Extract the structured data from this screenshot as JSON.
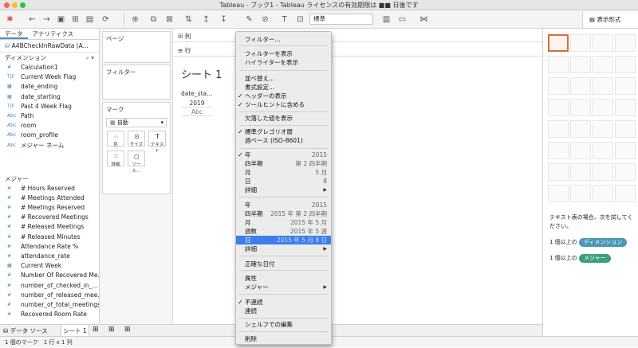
{
  "window": {
    "title": "Tableau - ブック1 - Tableau ライセンスの有効期限は ■■ 日後です"
  },
  "toolbar": {
    "fit_value": "標準",
    "show_me_label": "表示形式"
  },
  "left_pane": {
    "tab_data": "データ",
    "tab_analytics": "アナリティクス",
    "datasource": "A4BCheckInRawData (A...",
    "dimensions_header": "ディメンション",
    "dimensions": [
      {
        "icon": "#",
        "label": "Calculation1"
      },
      {
        "icon": "T|F",
        "label": "Current Week Flag"
      },
      {
        "icon": "▦",
        "label": "date_ending"
      },
      {
        "icon": "▦",
        "label": "date_starting"
      },
      {
        "icon": "T|F",
        "label": "Past 4 Week Flag"
      },
      {
        "icon": "Abc",
        "label": "Path"
      },
      {
        "icon": "Abc",
        "label": "room"
      },
      {
        "icon": "Abc",
        "label": "room_profile"
      },
      {
        "icon": "Abc",
        "label": "メジャー ネーム"
      }
    ],
    "measures_header": "メジャー",
    "measures": [
      {
        "icon": "#",
        "label": "# Hours Reserved"
      },
      {
        "icon": "#",
        "label": "# Meetings Attended"
      },
      {
        "icon": "#",
        "label": "# Meetings Reserved"
      },
      {
        "icon": "#",
        "label": "# Recovered Meetings"
      },
      {
        "icon": "#",
        "label": "# Released Meetings"
      },
      {
        "icon": "#",
        "label": "# Released Minutes"
      },
      {
        "icon": "#",
        "label": "Attendance Rate %"
      },
      {
        "icon": "#",
        "label": "attendance_rate"
      },
      {
        "icon": "▦",
        "label": "Current Week"
      },
      {
        "icon": "#",
        "label": "Number Of Recovered Me..."
      },
      {
        "icon": "#",
        "label": "number_of_checked_in_..."
      },
      {
        "icon": "#",
        "label": "number_of_released_mee..."
      },
      {
        "icon": "#",
        "label": "number_of_total_meetings"
      },
      {
        "icon": "#",
        "label": "Recovered Room Rate"
      }
    ]
  },
  "cards": {
    "pages": "ページ",
    "filters": "フィルター",
    "marks": "マーク",
    "mark_type": "自動",
    "buttons": [
      "色",
      "サイズ",
      "テキスト",
      "詳細",
      "ツール..."
    ]
  },
  "shelves": {
    "columns": "iii 列",
    "rows": "≡ 行"
  },
  "view": {
    "sheet_title": "シート 1",
    "col_header": "date_sta...",
    "year": "2019",
    "placeholder": "Abc"
  },
  "show_me": {
    "hint": "テキスト表の場合、次を試してください。",
    "req1": "1 個以上の",
    "dim": "ディメンション",
    "req2": "1 個以上の",
    "meas": "メジャー"
  },
  "bottom": {
    "datasource_tab": "データ ソース",
    "sheet_tab": "シート 1"
  },
  "status": {
    "marks": "1 個のマーク",
    "rowcol": "1 行 x 1 列"
  },
  "context_menu": {
    "items": [
      {
        "label": "フィルター...",
        "check": "",
        "value": ""
      },
      {
        "label": "フィルターを表示",
        "check": "",
        "value": ""
      },
      {
        "label": "ハイライターを表示",
        "check": "",
        "value": ""
      },
      {
        "label": "並べ替え...",
        "check": "",
        "value": ""
      },
      {
        "label": "書式設定...",
        "check": "",
        "value": ""
      },
      {
        "label": "ヘッダーの表示",
        "check": "✓",
        "value": ""
      },
      {
        "label": "ツールヒントに含める",
        "check": "✓",
        "value": ""
      },
      {
        "label": "欠落した値を表示",
        "check": "",
        "value": ""
      },
      {
        "label": "標準グレゴリオ暦",
        "check": "✓",
        "value": ""
      },
      {
        "label": "週ベース (ISO-8601)",
        "check": "",
        "value": ""
      },
      {
        "label": "年",
        "check": "✓",
        "value": "2015"
      },
      {
        "label": "四半期",
        "check": "",
        "value": "第 2 四半期"
      },
      {
        "label": "月",
        "check": "",
        "value": "5 月"
      },
      {
        "label": "日",
        "check": "",
        "value": "8"
      },
      {
        "label": "詳細",
        "check": "",
        "value": ""
      },
      {
        "label": "年",
        "check": "",
        "value": "2015"
      },
      {
        "label": "四半期",
        "check": "",
        "value": "2015 年 第 2 四半期"
      },
      {
        "label": "月",
        "check": "",
        "value": "2015 年 5 月"
      },
      {
        "label": "週数",
        "check": "",
        "value": "2015 年 5 週"
      },
      {
        "label": "日",
        "check": "",
        "value": "2015 年 5 月 8 日"
      },
      {
        "label": "詳細",
        "check": "",
        "value": ""
      },
      {
        "label": "正確な日付",
        "check": "",
        "value": ""
      },
      {
        "label": "属性",
        "check": "",
        "value": ""
      },
      {
        "label": "メジャー",
        "check": "",
        "value": ""
      },
      {
        "label": "不連続",
        "check": "✓",
        "value": ""
      },
      {
        "label": "連続",
        "check": "",
        "value": ""
      },
      {
        "label": "シェルフでの編集",
        "check": "",
        "value": ""
      },
      {
        "label": "削除",
        "check": "",
        "value": ""
      }
    ]
  }
}
